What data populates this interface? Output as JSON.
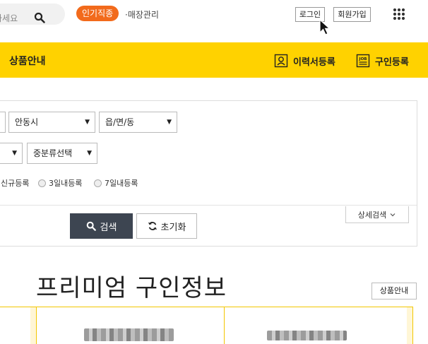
{
  "header": {
    "search_placeholder": "하세요",
    "hot_badge": "인기직종",
    "store_link": "·매장관리",
    "login": "로그인",
    "signup": "회원가입"
  },
  "nav": {
    "title": "상품안내",
    "resume": "이력서등록",
    "recruit": "구인등록",
    "bg_color": "#ffd200"
  },
  "filters": {
    "region_city": "안동시",
    "region_dong": "읍/면/동",
    "category_mid": "중분류선택",
    "radio_options": [
      "신규등록",
      "3일내등록",
      "7일내등록"
    ],
    "search_label": "검색",
    "reset_label": "초기화",
    "detail_label": "상세검색"
  },
  "premium": {
    "title": "프리미엄 구인정보",
    "product_button": "상품안내",
    "accent_color": "#f3c600"
  }
}
